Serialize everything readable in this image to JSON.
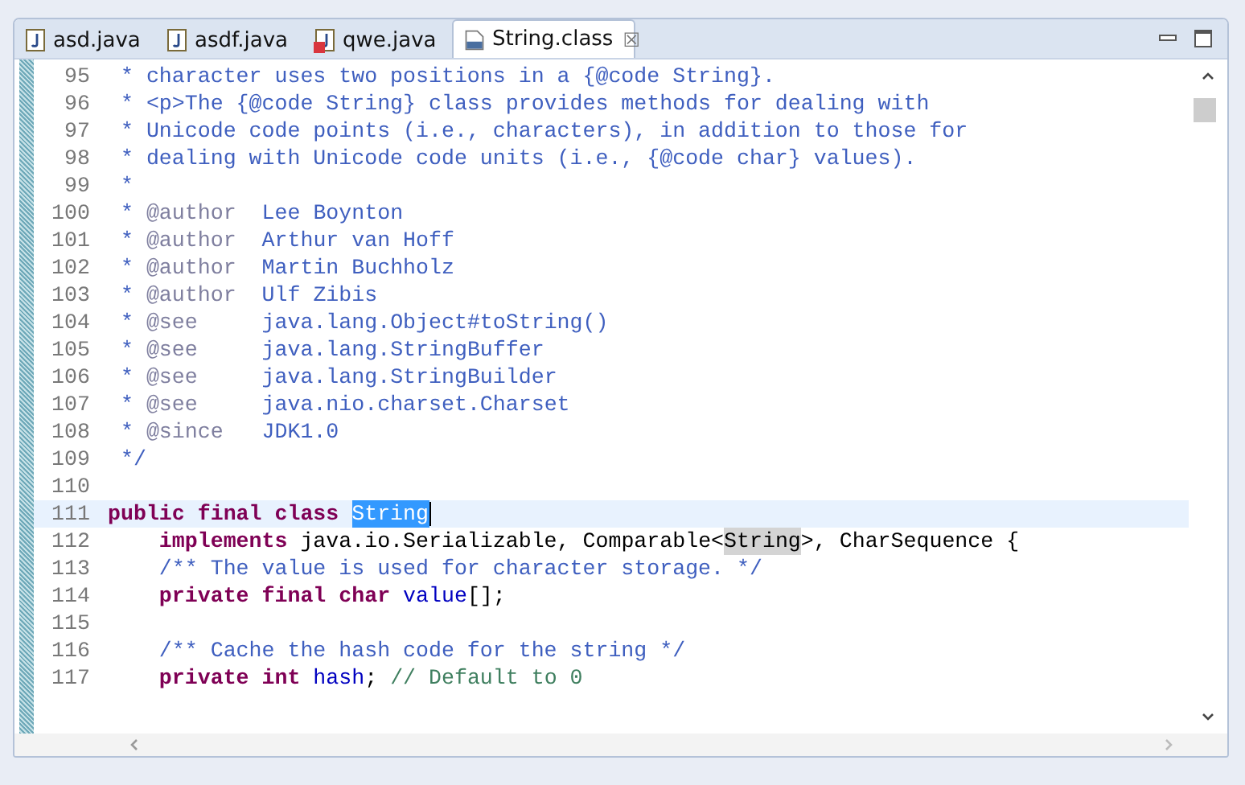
{
  "tabs": [
    {
      "label": "asd.java",
      "kind": "java",
      "selected": false
    },
    {
      "label": "asdf.java",
      "kind": "java",
      "selected": false
    },
    {
      "label": "qwe.java",
      "kind": "java-error",
      "selected": false
    },
    {
      "label": "String.class",
      "kind": "class",
      "selected": true,
      "close": "☒"
    }
  ],
  "lines": [
    {
      "number": "95",
      "current": false,
      "segments": [
        {
          "kind": "comment",
          "text": " * character uses two positions in a {@code String}."
        }
      ]
    },
    {
      "number": "96",
      "current": false,
      "segments": [
        {
          "kind": "comment",
          "text": " * <p>The {@code String} class provides methods for dealing with"
        }
      ]
    },
    {
      "number": "97",
      "current": false,
      "segments": [
        {
          "kind": "comment",
          "text": " * Unicode code points (i.e., characters), in addition to those for"
        }
      ]
    },
    {
      "number": "98",
      "current": false,
      "segments": [
        {
          "kind": "comment",
          "text": " * dealing with Unicode code units (i.e., {@code char} values)."
        }
      ]
    },
    {
      "number": "99",
      "current": false,
      "segments": [
        {
          "kind": "comment",
          "text": " *"
        }
      ]
    },
    {
      "number": "100",
      "current": false,
      "segments": [
        {
          "kind": "comment",
          "text": " * "
        },
        {
          "kind": "doctag",
          "text": "@author"
        },
        {
          "kind": "comment",
          "text": "  Lee Boynton"
        }
      ]
    },
    {
      "number": "101",
      "current": false,
      "segments": [
        {
          "kind": "comment",
          "text": " * "
        },
        {
          "kind": "doctag",
          "text": "@author"
        },
        {
          "kind": "comment",
          "text": "  Arthur van Hoff"
        }
      ]
    },
    {
      "number": "102",
      "current": false,
      "segments": [
        {
          "kind": "comment",
          "text": " * "
        },
        {
          "kind": "doctag",
          "text": "@author"
        },
        {
          "kind": "comment",
          "text": "  Martin Buchholz"
        }
      ]
    },
    {
      "number": "103",
      "current": false,
      "segments": [
        {
          "kind": "comment",
          "text": " * "
        },
        {
          "kind": "doctag",
          "text": "@author"
        },
        {
          "kind": "comment",
          "text": "  Ulf Zibis"
        }
      ]
    },
    {
      "number": "104",
      "current": false,
      "segments": [
        {
          "kind": "comment",
          "text": " * "
        },
        {
          "kind": "doctag",
          "text": "@see"
        },
        {
          "kind": "comment",
          "text": "     java.lang.Object#toString()"
        }
      ]
    },
    {
      "number": "105",
      "current": false,
      "segments": [
        {
          "kind": "comment",
          "text": " * "
        },
        {
          "kind": "doctag",
          "text": "@see"
        },
        {
          "kind": "comment",
          "text": "     java.lang.StringBuffer"
        }
      ]
    },
    {
      "number": "106",
      "current": false,
      "segments": [
        {
          "kind": "comment",
          "text": " * "
        },
        {
          "kind": "doctag",
          "text": "@see"
        },
        {
          "kind": "comment",
          "text": "     java.lang.StringBuilder"
        }
      ]
    },
    {
      "number": "107",
      "current": false,
      "segments": [
        {
          "kind": "comment",
          "text": " * "
        },
        {
          "kind": "doctag",
          "text": "@see"
        },
        {
          "kind": "comment",
          "text": "     java.nio.charset.Charset"
        }
      ]
    },
    {
      "number": "108",
      "current": false,
      "segments": [
        {
          "kind": "comment",
          "text": " * "
        },
        {
          "kind": "doctag",
          "text": "@since"
        },
        {
          "kind": "comment",
          "text": "   JDK1.0"
        }
      ]
    },
    {
      "number": "109",
      "current": false,
      "segments": [
        {
          "kind": "comment",
          "text": " */"
        }
      ]
    },
    {
      "number": "110",
      "current": false
    },
    {
      "number": "111",
      "current": true,
      "segments": [
        {
          "kind": "keyword",
          "text": "public final class "
        },
        {
          "kind": "selection",
          "text": "String"
        }
      ]
    },
    {
      "number": "112",
      "current": false,
      "segments": [
        {
          "kind": "keyword",
          "text": "    implements "
        },
        {
          "kind": "plain",
          "text": "java.io.Serializable, Comparable<"
        },
        {
          "kind": "occurrence",
          "text": "String"
        },
        {
          "kind": "plain",
          "text": ">, CharSequence {"
        }
      ]
    },
    {
      "number": "113",
      "current": false,
      "segments": [
        {
          "kind": "comment",
          "text": "    /** The value is used for character storage. */"
        }
      ]
    },
    {
      "number": "114",
      "current": false,
      "segments": [
        {
          "kind": "keyword",
          "text": "    private final char "
        },
        {
          "kind": "field",
          "text": "value"
        },
        {
          "kind": "plain",
          "text": "[];"
        }
      ]
    },
    {
      "number": "115",
      "current": false
    },
    {
      "number": "116",
      "current": false,
      "segments": [
        {
          "kind": "comment",
          "text": "    /** Cache the hash code for the string */"
        }
      ]
    },
    {
      "number": "117",
      "current": false,
      "segments": [
        {
          "kind": "keyword",
          "text": "    private int "
        },
        {
          "kind": "field",
          "text": "hash"
        },
        {
          "kind": "plain",
          "text": "; "
        },
        {
          "kind": "linecomment",
          "text": "// Default to 0"
        }
      ]
    }
  ]
}
